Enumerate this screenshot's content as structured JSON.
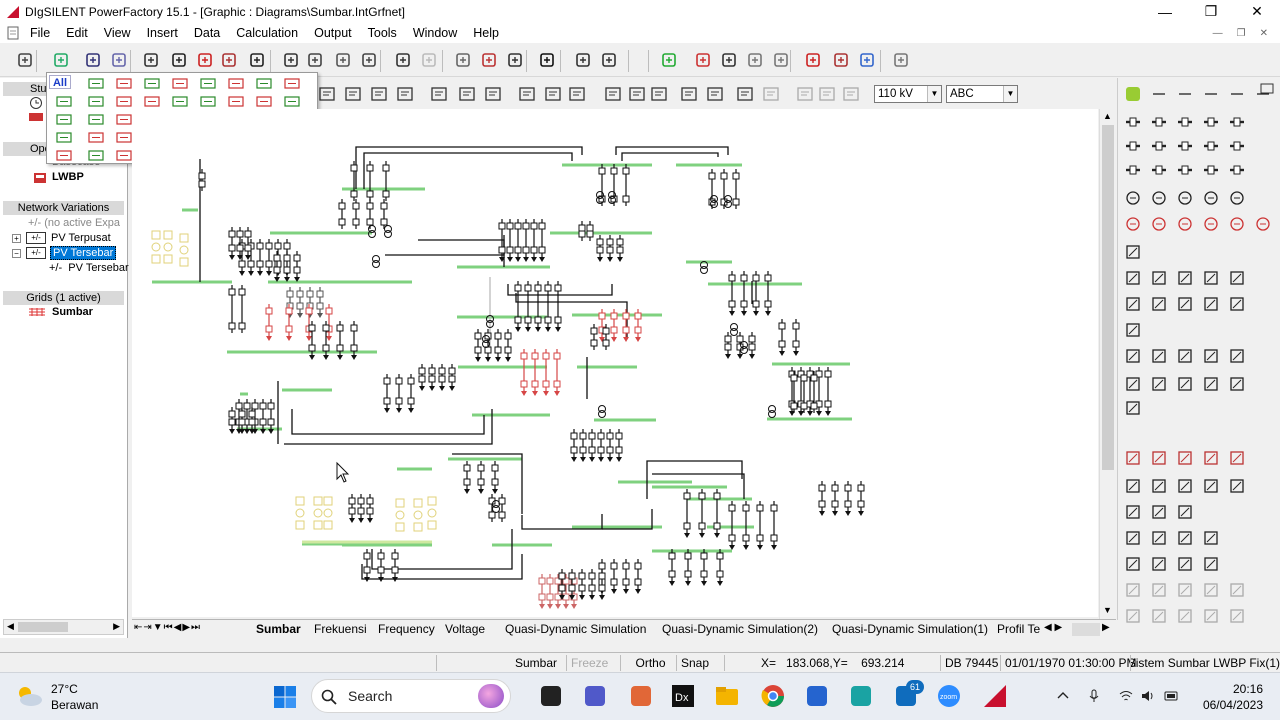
{
  "window": {
    "title": "DIgSILENT PowerFactory 15.1 - [Graphic : Diagrams\\Sumbar.IntGrfnet]"
  },
  "menu": [
    "File",
    "Edit",
    "View",
    "Insert",
    "Data",
    "Calculation",
    "Output",
    "Tools",
    "Window",
    "Help"
  ],
  "toolbar2": {
    "voltage_select": "110 kV",
    "text_select": "ABC"
  },
  "palette": {
    "all_label": "All"
  },
  "left_panel": {
    "study_head": "Stu",
    "operation_head": "Ope",
    "basecase": "Basecase",
    "lwbp": "LWBP",
    "variations_head": "Network Variations",
    "no_active": "(no active Expa",
    "pv_terpusat": "PV Terpusat",
    "pv_tersebar": "PV Tersebar",
    "pv_tersebar_sub": "PV Tersebar",
    "grids_head": "Grids (1 active)",
    "grid_sumbar": "Sumbar",
    "sign_minus": "+/-"
  },
  "tabs": [
    "Sumbar",
    "Frekuensi",
    "Frequency",
    "Voltage",
    "Quasi-Dynamic Simulation",
    "Quasi-Dynamic Simulation(2)",
    "Quasi-Dynamic Simulation(1)",
    "Profil Te"
  ],
  "statusbar": {
    "grid": "Sumbar",
    "freeze": "Freeze",
    "ortho": "Ortho",
    "snap": "Snap",
    "coords": "X=   183.068,Y=    693.214",
    "db": "DB 79445",
    "datetime": "01/01/1970 01:30:00 PM",
    "project": "Sistem Sumbar LWBP Fix(1)"
  },
  "taskbar": {
    "weather_temp": "27°C",
    "weather_desc": "Berawan",
    "search": "Search",
    "badge": "61",
    "time": "20:16",
    "date": "06/04/2023"
  }
}
